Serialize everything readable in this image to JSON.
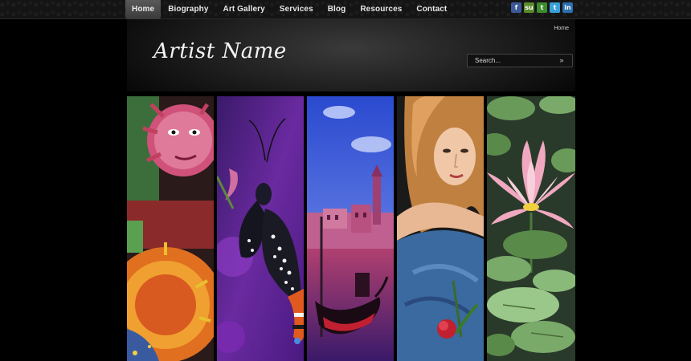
{
  "nav": {
    "items": [
      {
        "label": "Home",
        "active": true
      },
      {
        "label": "Biography"
      },
      {
        "label": "Art Gallery"
      },
      {
        "label": "Services"
      },
      {
        "label": "Blog"
      },
      {
        "label": "Resources"
      },
      {
        "label": "Contact"
      }
    ]
  },
  "social": [
    {
      "icon": "facebook-icon",
      "glyph": "f",
      "color": "#3b5998"
    },
    {
      "icon": "stumbleupon-icon",
      "glyph": "su",
      "color": "#5a8a2c"
    },
    {
      "icon": "technorati-icon",
      "glyph": "t",
      "color": "#3c8c2c"
    },
    {
      "icon": "twitter-icon",
      "glyph": "t",
      "color": "#3aa0d8"
    },
    {
      "icon": "linkedin-icon",
      "glyph": "in",
      "color": "#2a6fb0"
    }
  ],
  "breadcrumb": "Home",
  "logo_text": "Artist Name",
  "search": {
    "placeholder": "Search...",
    "go_glyph": "»"
  },
  "gallery": [
    {
      "name": "gallery-panel-sun-mosaic"
    },
    {
      "name": "gallery-panel-butterfly"
    },
    {
      "name": "gallery-panel-venice-gondola"
    },
    {
      "name": "gallery-panel-portrait"
    },
    {
      "name": "gallery-panel-water-lily"
    }
  ]
}
